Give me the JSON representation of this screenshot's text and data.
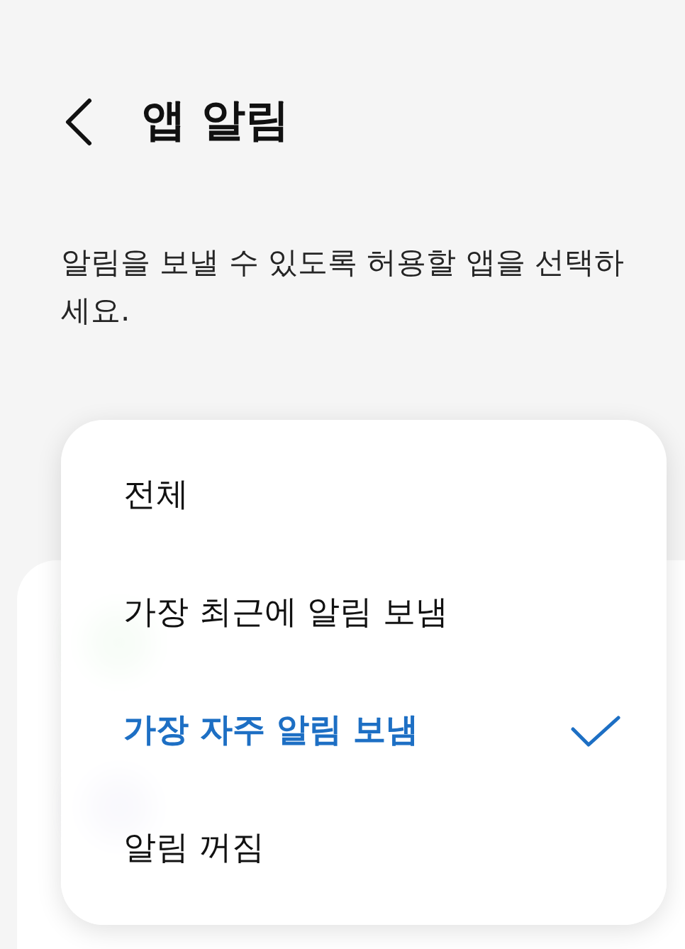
{
  "header": {
    "title": "앱 알림"
  },
  "description": "알림을 보낼 수 있도록 허용할 앱을 선택하세요.",
  "sort_menu": {
    "items": [
      {
        "label": "전체",
        "selected": false
      },
      {
        "label": "가장 최근에 알림 보냄",
        "selected": false
      },
      {
        "label": "가장 자주 알림 보냄",
        "selected": true
      },
      {
        "label": "알림 꺼짐",
        "selected": false
      }
    ]
  }
}
